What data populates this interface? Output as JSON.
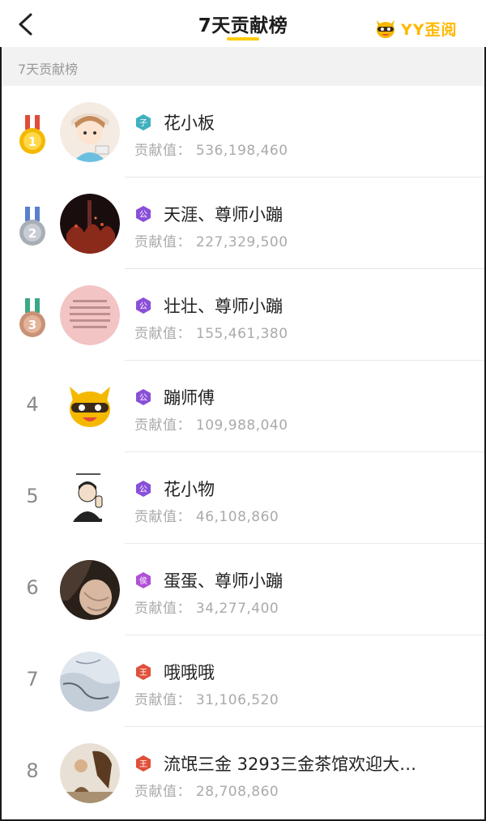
{
  "header": {
    "title": "7天贡献榜",
    "brand": "YY歪阅"
  },
  "section": {
    "label": "7天贡献榜"
  },
  "contrib_label": "贡献值：",
  "rows": [
    {
      "rank": "1",
      "name": "花小板",
      "value": "536,198,460"
    },
    {
      "rank": "2",
      "name": "天涯、尊师小蹦",
      "value": "227,329,500"
    },
    {
      "rank": "3",
      "name": "壮壮、尊师小蹦",
      "value": "155,461,380"
    },
    {
      "rank": "4",
      "name": "蹦师傅",
      "value": "109,988,040"
    },
    {
      "rank": "5",
      "name": "花小物",
      "value": "46,108,860"
    },
    {
      "rank": "6",
      "name": "蛋蛋、尊师小蹦",
      "value": "34,277,400"
    },
    {
      "rank": "7",
      "name": "哦哦哦",
      "value": "31,106,520"
    },
    {
      "rank": "8",
      "name": "流氓三金 3293三金茶馆欢迎大…",
      "value": "28,708,860"
    }
  ],
  "colors": {
    "accent": "#ffcc00",
    "gold": "#f5b800",
    "silver": "#b8bcc4",
    "bronze": "#d9a98c",
    "badge_teal": "#3fb0c0",
    "badge_purple": "#8a4fd8",
    "badge_magenta": "#b04fd8",
    "badge_red": "#e0503a"
  }
}
